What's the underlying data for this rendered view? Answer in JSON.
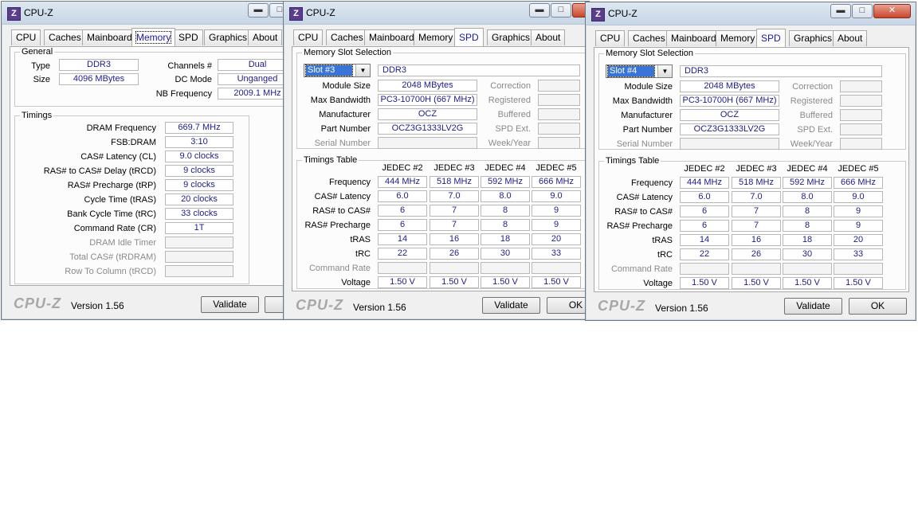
{
  "app": {
    "title": "CPU-Z",
    "footer_logo": "CPU-Z",
    "version": "Version 1.56",
    "validate": "Validate",
    "ok": "OK",
    "logo_char": "Z"
  },
  "tabs": [
    "CPU",
    "Caches",
    "Mainboard",
    "Memory",
    "SPD",
    "Graphics",
    "About"
  ],
  "memory": {
    "general_title": "General",
    "type_label": "Type",
    "type_value": "DDR3",
    "size_label": "Size",
    "size_value": "4096 MBytes",
    "channels_label": "Channels #",
    "channels_value": "Dual",
    "dcmode_label": "DC Mode",
    "dcmode_value": "Unganged",
    "nbfreq_label": "NB Frequency",
    "nbfreq_value": "2009.1 MHz",
    "timings_title": "Timings",
    "timings": [
      {
        "label": "DRAM Frequency",
        "value": "669.7 MHz"
      },
      {
        "label": "FSB:DRAM",
        "value": "3:10"
      },
      {
        "label": "CAS# Latency (CL)",
        "value": "9.0 clocks"
      },
      {
        "label": "RAS# to CAS# Delay (tRCD)",
        "value": "9 clocks"
      },
      {
        "label": "RAS# Precharge (tRP)",
        "value": "9 clocks"
      },
      {
        "label": "Cycle Time (tRAS)",
        "value": "20 clocks"
      },
      {
        "label": "Bank Cycle Time (tRC)",
        "value": "33 clocks"
      },
      {
        "label": "Command Rate (CR)",
        "value": "1T"
      },
      {
        "label": "DRAM Idle Timer",
        "value": ""
      },
      {
        "label": "Total CAS# (tRDRAM)",
        "value": ""
      },
      {
        "label": "Row To Column (tRCD)",
        "value": ""
      }
    ]
  },
  "spd_labels": {
    "slot_group": "Memory Slot Selection",
    "module_size": "Module Size",
    "max_bandwidth": "Max Bandwidth",
    "manufacturer": "Manufacturer",
    "part_number": "Part Number",
    "serial_number": "Serial Number",
    "correction": "Correction",
    "registered": "Registered",
    "buffered": "Buffered",
    "spd_ext": "SPD Ext.",
    "week_year": "Week/Year",
    "timings_table": "Timings Table",
    "row_labels": [
      "Frequency",
      "CAS# Latency",
      "RAS# to CAS#",
      "RAS# Precharge",
      "tRAS",
      "tRC",
      "Command Rate",
      "Voltage"
    ]
  },
  "spd_windows": [
    {
      "slot": "Slot #3",
      "type": "DDR3",
      "module_size": "2048 MBytes",
      "max_bandwidth": "PC3-10700H (667 MHz)",
      "manufacturer": "OCZ",
      "part_number": "OCZ3G1333LV2G",
      "columns": [
        "JEDEC #2",
        "JEDEC #3",
        "JEDEC #4",
        "JEDEC #5"
      ],
      "rows": [
        [
          "444 MHz",
          "518 MHz",
          "592 MHz",
          "666 MHz"
        ],
        [
          "6.0",
          "7.0",
          "8.0",
          "9.0"
        ],
        [
          "6",
          "7",
          "8",
          "9"
        ],
        [
          "6",
          "7",
          "8",
          "9"
        ],
        [
          "14",
          "16",
          "18",
          "20"
        ],
        [
          "22",
          "26",
          "30",
          "33"
        ],
        [
          "",
          "",
          "",
          ""
        ],
        [
          "1.50 V",
          "1.50 V",
          "1.50 V",
          "1.50 V"
        ]
      ]
    },
    {
      "slot": "Slot #4",
      "type": "DDR3",
      "module_size": "2048 MBytes",
      "max_bandwidth": "PC3-10700H (667 MHz)",
      "manufacturer": "OCZ",
      "part_number": "OCZ3G1333LV2G",
      "columns": [
        "JEDEC #2",
        "JEDEC #3",
        "JEDEC #4",
        "JEDEC #5"
      ],
      "rows": [
        [
          "444 MHz",
          "518 MHz",
          "592 MHz",
          "666 MHz"
        ],
        [
          "6.0",
          "7.0",
          "8.0",
          "9.0"
        ],
        [
          "6",
          "7",
          "8",
          "9"
        ],
        [
          "6",
          "7",
          "8",
          "9"
        ],
        [
          "14",
          "16",
          "18",
          "20"
        ],
        [
          "22",
          "26",
          "30",
          "33"
        ],
        [
          "",
          "",
          "",
          ""
        ],
        [
          "1.50 V",
          "1.50 V",
          "1.50 V",
          "1.50 V"
        ]
      ]
    }
  ]
}
